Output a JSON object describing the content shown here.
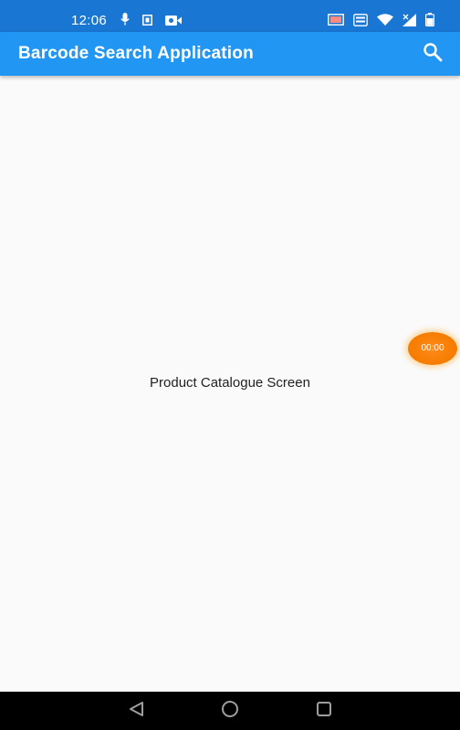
{
  "status_bar": {
    "time": "12:06",
    "icons_left": [
      "mic-icon",
      "sim-card-icon",
      "video-record-icon"
    ],
    "icons_right": [
      "cast-icon",
      "volte-icon",
      "wifi-icon",
      "signal-icon",
      "battery-icon"
    ]
  },
  "app_bar": {
    "title": "Barcode Search Application",
    "action_icon": "search-icon",
    "color": "#2196f3"
  },
  "main": {
    "text": "Product Catalogue Screen"
  },
  "recorder_overlay": {
    "time": "00:00",
    "color": "#f57c00"
  },
  "nav_bar": {
    "buttons": [
      "back-icon",
      "home-icon",
      "recents-icon"
    ]
  }
}
